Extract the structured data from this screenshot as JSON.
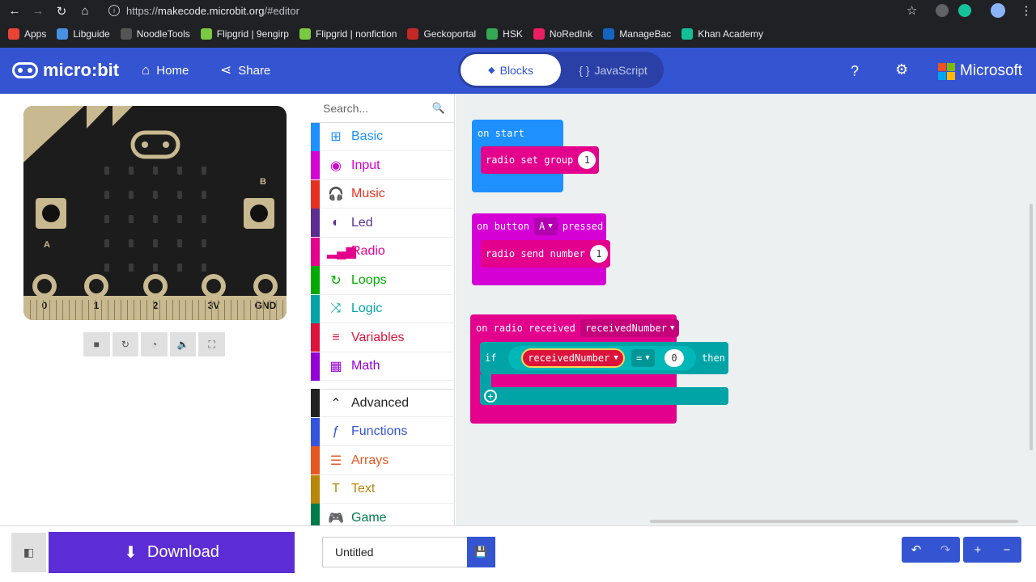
{
  "browser": {
    "url_prefix": "https://",
    "url_host": "makecode.microbit.org",
    "url_path": "/#editor",
    "bookmarks": [
      {
        "label": "Apps",
        "color": "#ea4335"
      },
      {
        "label": "Libguide",
        "color": "#4a90e2"
      },
      {
        "label": "NoodleTools",
        "color": "#555555"
      },
      {
        "label": "Flipgrid | 9engirp",
        "color": "#7ac943"
      },
      {
        "label": "Flipgrid | nonfiction",
        "color": "#7ac943"
      },
      {
        "label": "Geckoportal",
        "color": "#c62828"
      },
      {
        "label": "HSK",
        "color": "#34a853"
      },
      {
        "label": "NoRedInk",
        "color": "#e91e63"
      },
      {
        "label": "ManageBac",
        "color": "#1565c0"
      },
      {
        "label": "Khan Academy",
        "color": "#14bf96"
      }
    ]
  },
  "topbar": {
    "logo": "micro:bit",
    "home": "Home",
    "share": "Share",
    "tab_blocks": "Blocks",
    "tab_js": "JavaScript",
    "brand": "Microsoft"
  },
  "simulator": {
    "pins": [
      "0",
      "1",
      "2",
      "3V",
      "GND"
    ],
    "button_a": "A",
    "button_b": "B"
  },
  "toolbox": {
    "search_placeholder": "Search...",
    "categories": [
      {
        "label": "Basic",
        "color": "#1e90ff",
        "icon": "⊞"
      },
      {
        "label": "Input",
        "color": "#d400d4",
        "icon": "◉"
      },
      {
        "label": "Music",
        "color": "#e63022",
        "icon": "🎧"
      },
      {
        "label": "Led",
        "color": "#5c2d91",
        "icon": "◐"
      },
      {
        "label": "Radio",
        "color": "#e3008c",
        "icon": "▂▄▆"
      },
      {
        "label": "Loops",
        "color": "#00aa00",
        "icon": "↻"
      },
      {
        "label": "Logic",
        "color": "#00a4a6",
        "icon": "⤨"
      },
      {
        "label": "Variables",
        "color": "#dc143c",
        "icon": "≡"
      },
      {
        "label": "Math",
        "color": "#9400d3",
        "icon": "▦"
      }
    ],
    "advanced": "Advanced",
    "advanced_categories": [
      {
        "label": "Functions",
        "color": "#3455db",
        "icon": "ƒ"
      },
      {
        "label": "Arrays",
        "color": "#e65722",
        "icon": "☰"
      },
      {
        "label": "Text",
        "color": "#b8860b",
        "icon": "T"
      },
      {
        "label": "Game",
        "color": "#007a4b",
        "icon": "🎮"
      }
    ]
  },
  "workspace": {
    "on_start": {
      "label": "on start",
      "inner": "radio set group",
      "value": "1"
    },
    "on_button": {
      "label_pre": "on button",
      "button": "A",
      "label_post": "pressed",
      "inner": "radio send number",
      "value": "1"
    },
    "on_radio": {
      "label": "on radio received",
      "var": "receivedNumber",
      "if": "if",
      "cond_var": "receivedNumber",
      "op": "=",
      "cond_val": "0",
      "then": "then"
    }
  },
  "footer": {
    "download": "Download",
    "project_name": "Untitled"
  }
}
